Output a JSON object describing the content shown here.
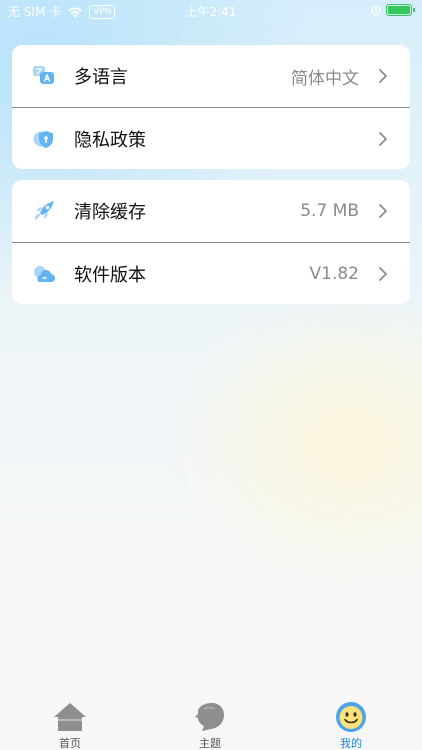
{
  "status_bar": {
    "carrier": "无 SIM 卡",
    "vpn": "VPN",
    "time": "上午2:41"
  },
  "settings": {
    "group1": [
      {
        "label": "多语言",
        "value": "简体中文",
        "icon": "translate-icon"
      },
      {
        "label": "隐私政策",
        "value": "",
        "icon": "privacy-shield-icon"
      }
    ],
    "group2": [
      {
        "label": "清除缓存",
        "value": "5.7 MB",
        "icon": "rocket-icon"
      },
      {
        "label": "软件版本",
        "value": "V1.82",
        "icon": "cloud-icon"
      }
    ]
  },
  "tabbar": {
    "items": [
      {
        "label": "首页",
        "icon": "home-icon"
      },
      {
        "label": "主题",
        "icon": "theme-head-icon"
      },
      {
        "label": "我的",
        "icon": "smiley-icon",
        "active": true
      }
    ],
    "active_color": "#1e88e5"
  },
  "colors": {
    "icon_blue": "#62b4f2",
    "divider": "#8a8a8a",
    "value_text": "#8a8a8a"
  }
}
